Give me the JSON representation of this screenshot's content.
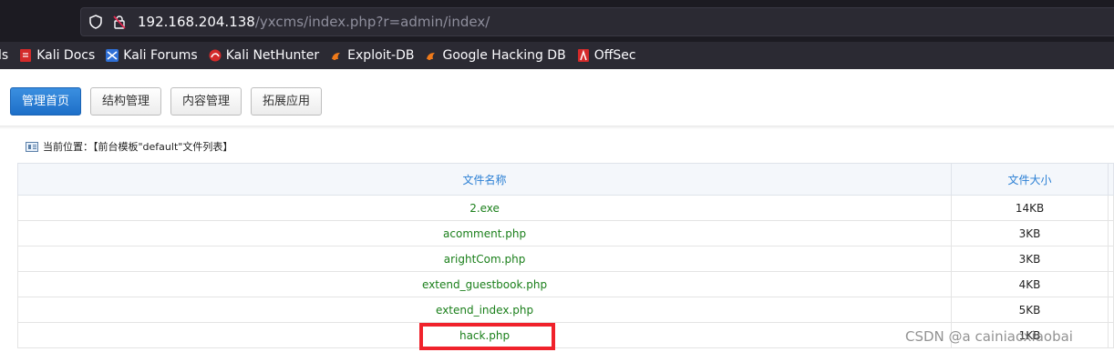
{
  "browser": {
    "url_host": "192.168.204.138",
    "url_path": "/yxcms/index.php?r=admin/index/",
    "bookmarks": [
      {
        "label": "ls",
        "icon": "none"
      },
      {
        "label": "Kali Docs",
        "icon": "kali-docs-icon"
      },
      {
        "label": "Kali Forums",
        "icon": "kali-forums-icon"
      },
      {
        "label": "Kali NetHunter",
        "icon": "kali-nethunter-icon"
      },
      {
        "label": "Exploit-DB",
        "icon": "exploit-db-icon"
      },
      {
        "label": "Google Hacking DB",
        "icon": "ghdb-icon"
      },
      {
        "label": "OffSec",
        "icon": "offsec-icon"
      }
    ]
  },
  "nav": {
    "tabs": [
      {
        "label": "管理首页",
        "active": true
      },
      {
        "label": "结构管理",
        "active": false
      },
      {
        "label": "内容管理",
        "active": false
      },
      {
        "label": "拓展应用",
        "active": false
      }
    ]
  },
  "location": {
    "text": "当前位置：【前台模板\"default\"文件列表】"
  },
  "table": {
    "headers": [
      "文件名称",
      "文件大小"
    ],
    "rows": [
      {
        "name": "2.exe",
        "size": "14KB"
      },
      {
        "name": "acomment.php",
        "size": "3KB"
      },
      {
        "name": "arightCom.php",
        "size": "3KB"
      },
      {
        "name": "extend_guestbook.php",
        "size": "4KB"
      },
      {
        "name": "extend_index.php",
        "size": "5KB"
      },
      {
        "name": "hack.php",
        "size": "1KB"
      }
    ]
  },
  "watermark": "CSDN @a cainiaoxiaobai",
  "colors": {
    "accent": "#1d6fc8",
    "header_text": "#2a7fd4",
    "file_link": "#1a7f1a",
    "highlight": "#f0222b"
  }
}
